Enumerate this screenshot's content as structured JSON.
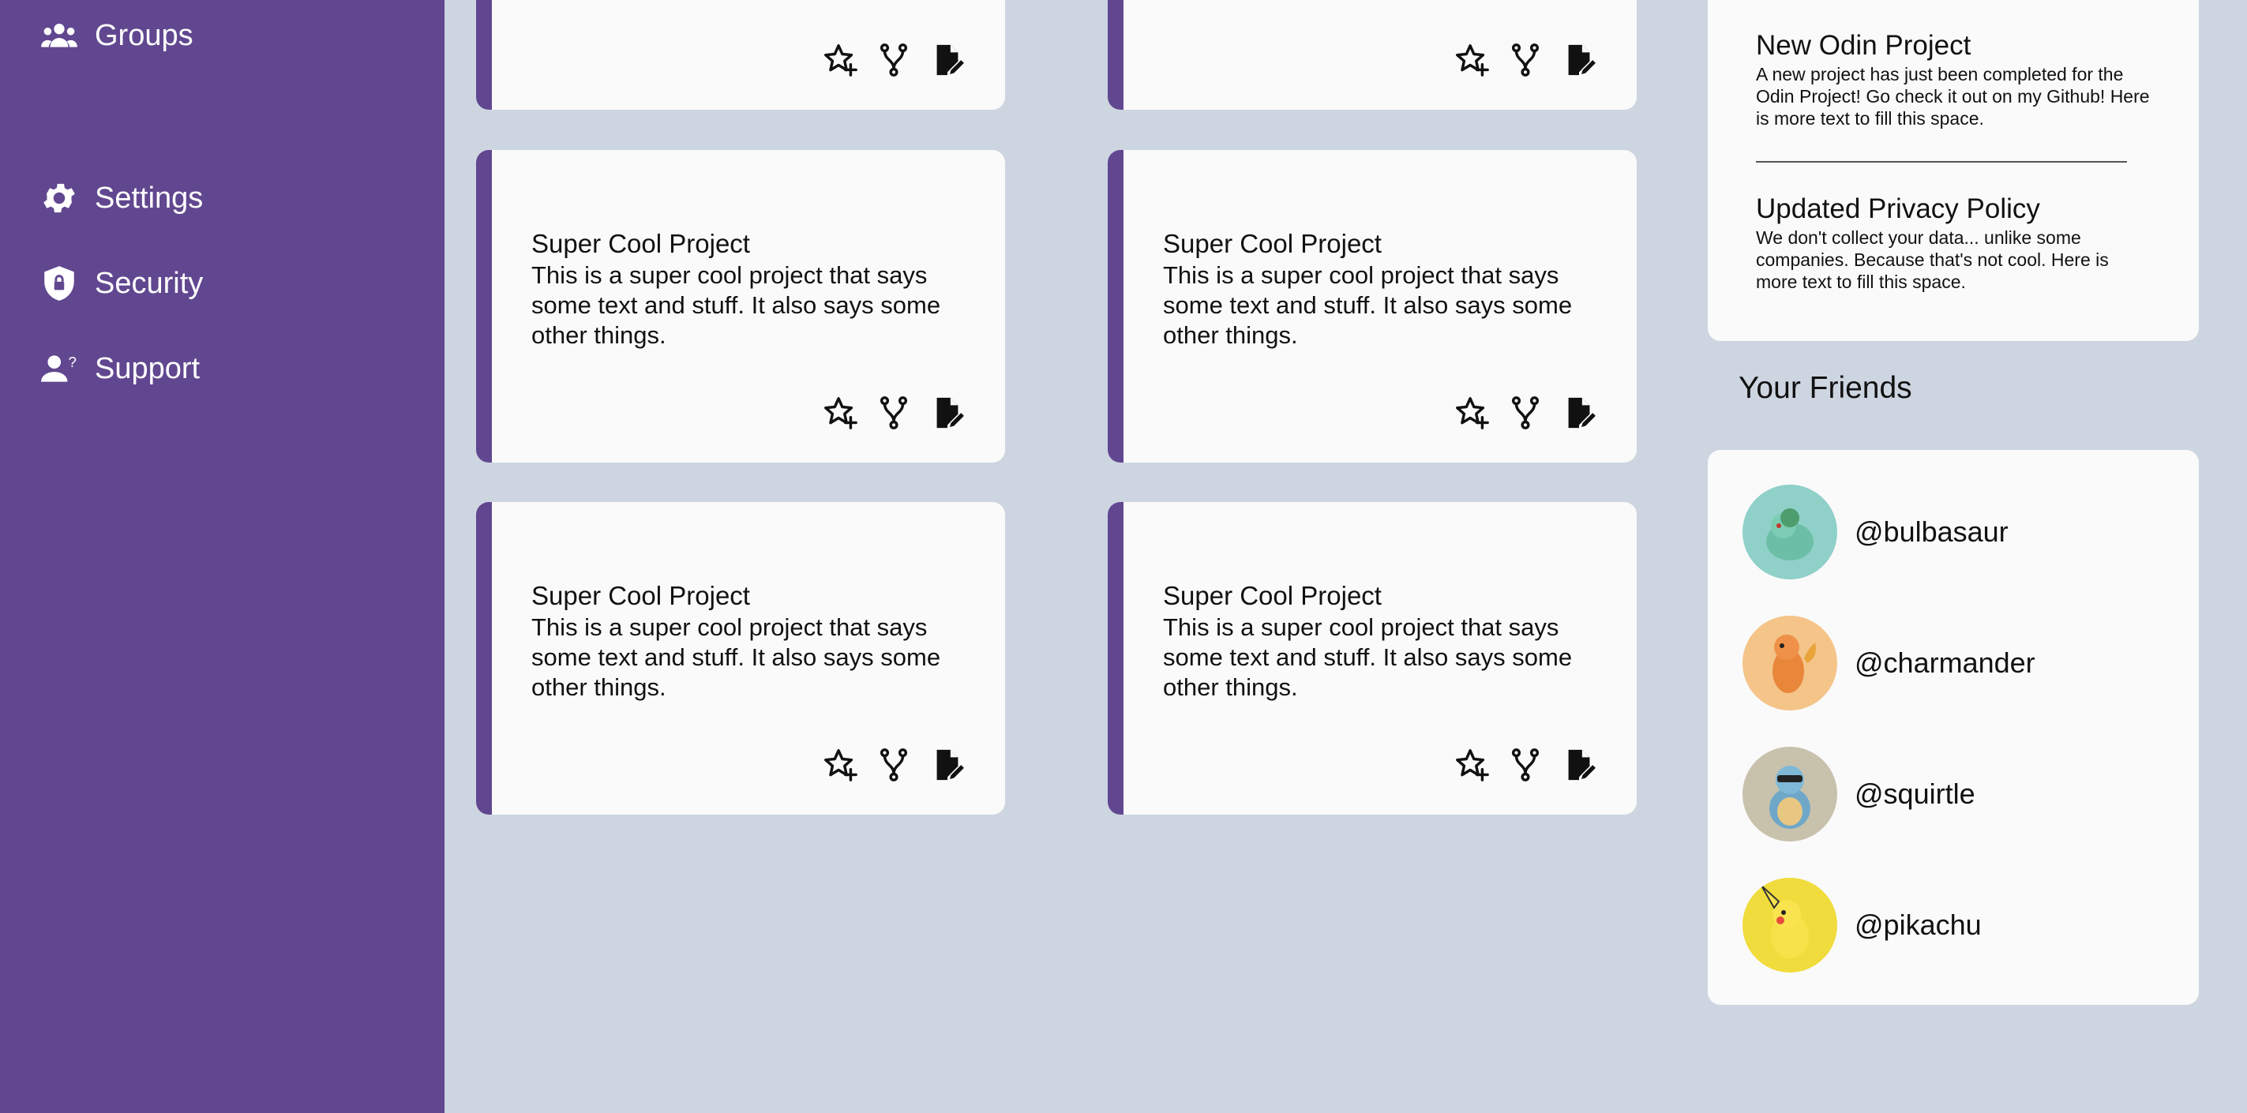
{
  "sidebar": {
    "items": [
      {
        "label": "Groups",
        "icon": "groups-icon"
      },
      {
        "label": "Settings",
        "icon": "gear-icon"
      },
      {
        "label": "Security",
        "icon": "shield-icon"
      },
      {
        "label": "Support",
        "icon": "support-icon"
      }
    ]
  },
  "projects": [
    {
      "title": "",
      "description": ""
    },
    {
      "title": "",
      "description": ""
    },
    {
      "title": "Super Cool Project",
      "description": "This is a super cool project that says some text and stuff. It also says some other things."
    },
    {
      "title": "Super Cool Project",
      "description": "This is a super cool project that says some text and stuff. It also says some other things."
    },
    {
      "title": "Super Cool Project",
      "description": "This is a super cool project that says some text and stuff. It also says some other things."
    },
    {
      "title": "Super Cool Project",
      "description": "This is a super cool project that says some text and stuff. It also says some other things."
    }
  ],
  "announcements": [
    {
      "title": "New Odin Project",
      "text": "A new project has just been completed for the Odin Project! Go check it out on my Github! Here is more text to fill this space."
    },
    {
      "title": "Updated Privacy Policy",
      "text": "We don't collect your data... unlike some companies. Because that's not cool. Here is more text to fill this space."
    }
  ],
  "friends": {
    "heading": "Your Friends",
    "list": [
      {
        "handle": "@bulbasaur",
        "color": "#8fd0c8"
      },
      {
        "handle": "@charmander",
        "color": "#f4c489"
      },
      {
        "handle": "@squirtle",
        "color": "#c8c2ad"
      },
      {
        "handle": "@pikachu",
        "color": "#f0dc3c"
      }
    ]
  },
  "colors": {
    "accent": "#61478f",
    "background": "#cdd5e1",
    "card": "#fafafa"
  }
}
